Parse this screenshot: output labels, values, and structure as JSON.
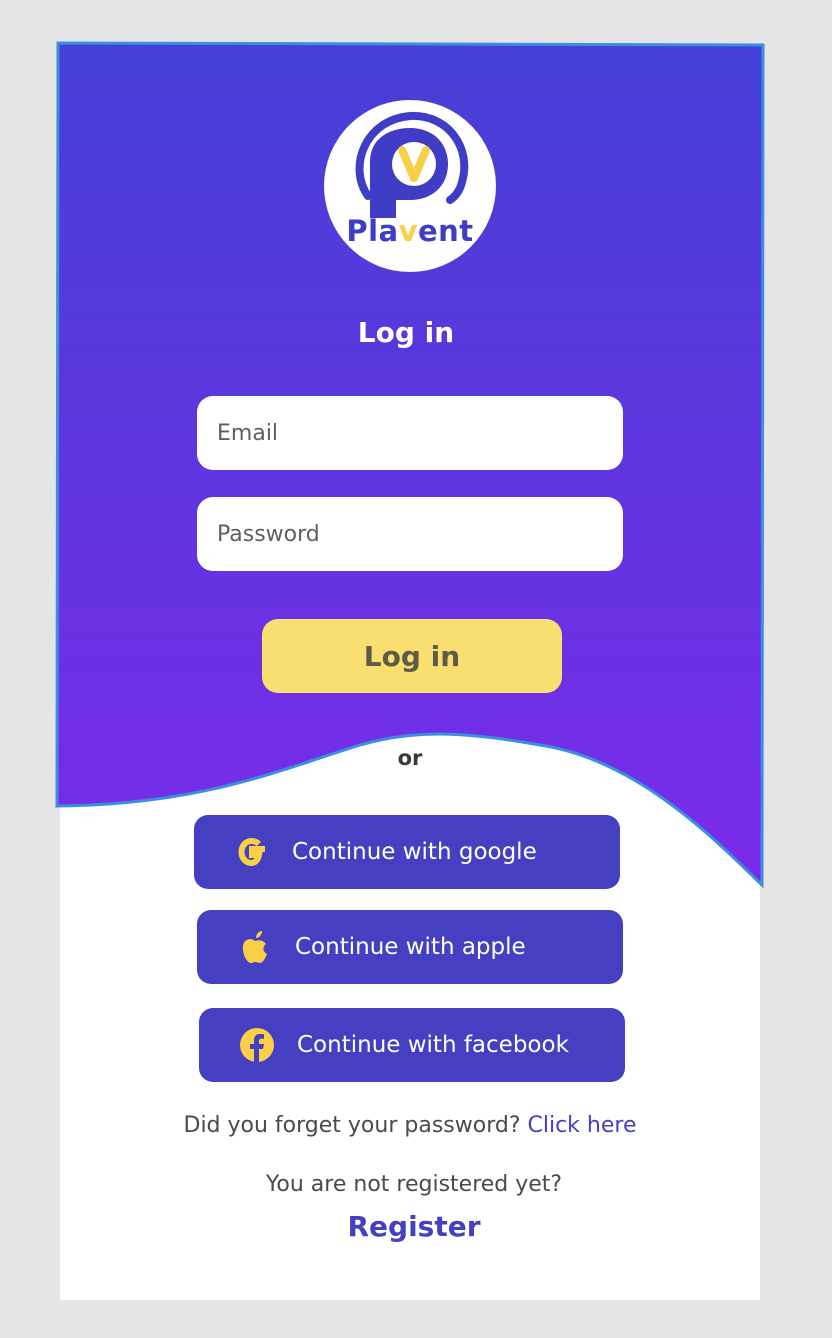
{
  "brand": {
    "name_part1": "Pla",
    "name_accent": "v",
    "name_part2": "ent"
  },
  "form": {
    "title": "Log in",
    "email_placeholder": "Email",
    "password_placeholder": "Password",
    "submit_label": "Log in",
    "divider": "or"
  },
  "social": [
    {
      "label": "Continue with google",
      "icon": "google-icon"
    },
    {
      "label": "Continue with apple",
      "icon": "apple-icon"
    },
    {
      "label": "Continue with facebook",
      "icon": "facebook-icon"
    }
  ],
  "footer": {
    "forgot_text": "Did you forget your password?",
    "forgot_link": "Click here",
    "not_registered_text": "You are not registered yet?",
    "register_link": "Register"
  },
  "colors": {
    "page_bg": "#e5e5e5",
    "gradient_top": "#4540d6",
    "gradient_bottom": "#7a2be9",
    "primary": "#4540c2",
    "accent_yellow": "#f9df6f",
    "outline": "#3b8fe0"
  }
}
